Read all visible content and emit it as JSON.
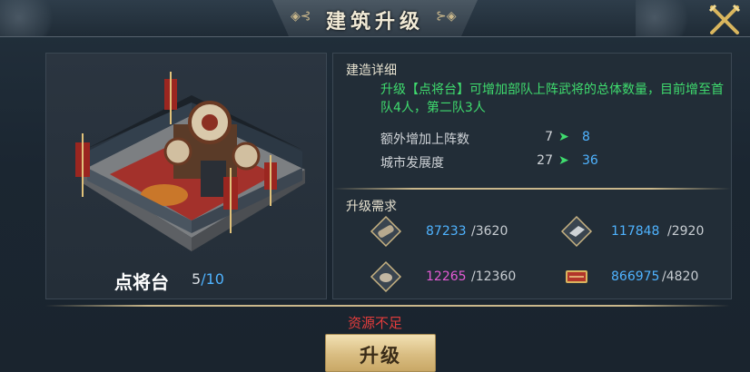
{
  "window": {
    "title": "建筑升级"
  },
  "building": {
    "name": "点将台",
    "level": "5",
    "max_level": "10",
    "level_sep": "/"
  },
  "details": {
    "section_title": "建造详细",
    "description": "升级【点将台】可增加部队上阵武将的总体数量，目前增至首队4人，第二队3人",
    "stats": [
      {
        "label": "额外增加上阵数",
        "current": "7",
        "next": "8"
      },
      {
        "label": "城市发展度",
        "current": "27",
        "next": "36"
      }
    ]
  },
  "requirements": {
    "section_title": "升级需求",
    "items": [
      {
        "icon": "wood-icon",
        "have": "87233",
        "need": "/3620",
        "have_color": "#4fb3ff"
      },
      {
        "icon": "iron-icon",
        "have": "117848",
        "need": "/2920",
        "have_color": "#4fb3ff"
      },
      {
        "icon": "stone-icon",
        "have": "12265",
        "need": "/12360",
        "have_color": "#e35bd4"
      },
      {
        "icon": "grain-icon",
        "have": "866975",
        "need": "/4820",
        "have_color": "#4fb3ff"
      }
    ]
  },
  "footer": {
    "warning": "资源不足",
    "upgrade_label": "升级"
  }
}
